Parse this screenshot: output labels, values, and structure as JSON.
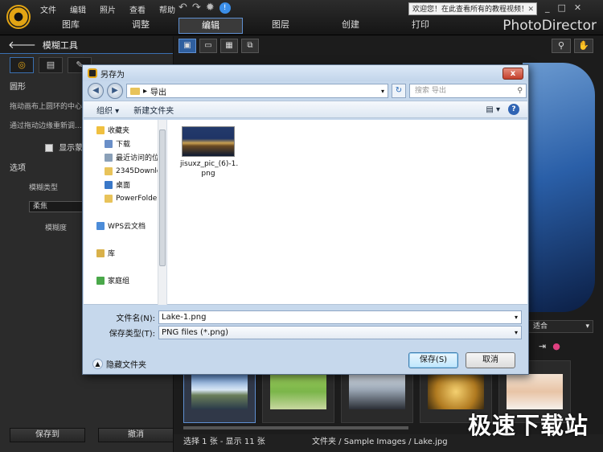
{
  "app": {
    "menu": [
      "文件",
      "编辑",
      "照片",
      "查看",
      "帮助"
    ],
    "welcome_text": "欢迎您！在此查看所有的教程视频！",
    "window_controls": [
      "_",
      "□",
      "✕"
    ],
    "tabs": [
      "图库",
      "调整",
      "编辑",
      "图层",
      "创建",
      "打印"
    ],
    "active_tab": "编辑",
    "brand": "PhotoDirector"
  },
  "left_panel": {
    "header": "模糊工具",
    "section_shape": "圆形",
    "desc1": "拖动画布上圆环的中心... 模糊特效的位置。",
    "desc2": "通过拖动边缘重新调... 拖动虚线可设置渐变...",
    "show_checkbox": "显示蒙...",
    "options_title": "选项",
    "blur_type_label": "模糊类型",
    "blur_type_value": "柔焦",
    "blur_amount_label": "模糊度",
    "save_btn": "保存到",
    "undo_btn": "撤消"
  },
  "view": {
    "fit_label": "适合",
    "status_left": "选择 1 张 - 显示 11 张",
    "status_path": "文件夹 / Sample Images / Lake.jpg"
  },
  "watermark": "极速下载站",
  "dialog": {
    "title": "另存为",
    "close": "x",
    "address": "导出",
    "search_placeholder": "搜索 导出",
    "organize": "组织 ▾",
    "new_folder": "新建文件夹",
    "nav_items": [
      {
        "label": "收藏夹",
        "icon": "star-icon",
        "color": "#f0c040",
        "sub": false
      },
      {
        "label": "下载",
        "icon": "download-folder-icon",
        "color": "#6a8fc8",
        "sub": true
      },
      {
        "label": "最近访问的位",
        "icon": "recent-places-icon",
        "color": "#8aa0b8",
        "sub": true
      },
      {
        "label": "2345Downlo",
        "icon": "folder-icon",
        "color": "#e8c35a",
        "sub": true
      },
      {
        "label": "桌面",
        "icon": "desktop-icon",
        "color": "#3a78c8",
        "sub": true
      },
      {
        "label": "PowerFolde",
        "icon": "folder-icon",
        "color": "#e8c35a",
        "sub": true
      },
      {
        "label": "",
        "icon": "",
        "color": "",
        "sub": false
      },
      {
        "label": "WPS云文档",
        "icon": "cloud-icon",
        "color": "#4c8cd8",
        "sub": false
      },
      {
        "label": "",
        "icon": "",
        "color": "",
        "sub": false
      },
      {
        "label": "库",
        "icon": "library-icon",
        "color": "#d9b14a",
        "sub": false
      },
      {
        "label": "",
        "icon": "",
        "color": "",
        "sub": false
      },
      {
        "label": "家庭组",
        "icon": "homegroup-icon",
        "color": "#4aa84a",
        "sub": false
      }
    ],
    "file": {
      "name": "jisuxz_pic_(6)-1.",
      "name2": "png"
    },
    "filename_label": "文件名(N):",
    "filename_value": "Lake-1.png",
    "filetype_label": "保存类型(T):",
    "filetype_value": "PNG files (*.png)",
    "hide_folders": "隐藏文件夹",
    "save_btn": "保存(S)",
    "cancel_btn": "取消"
  }
}
